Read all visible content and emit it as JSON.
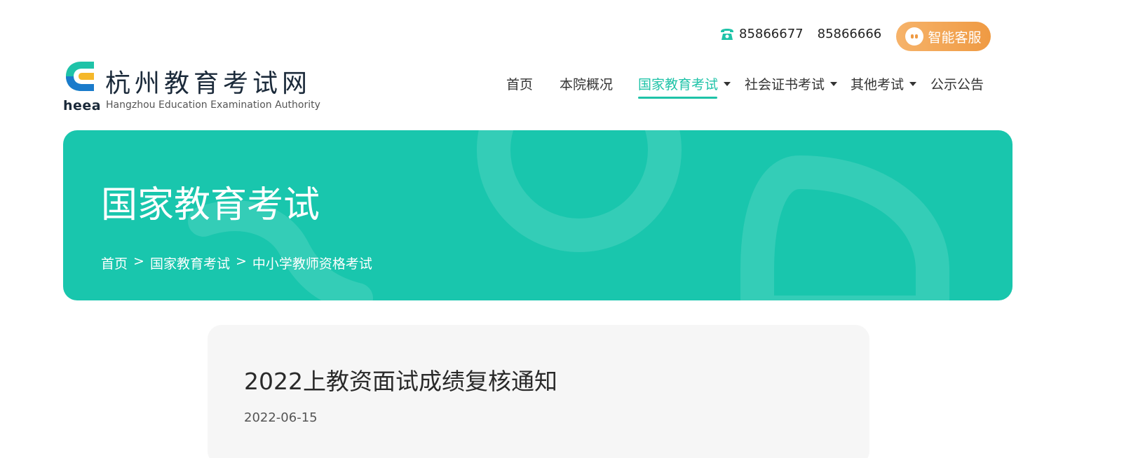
{
  "topbar": {
    "phone_1": "85866677",
    "phone_2": "85866666",
    "service_label": "智能客服"
  },
  "logo": {
    "mark_text": "heea",
    "name_cn": "杭州教育考试网",
    "name_en": "Hangzhou Education Examination Authority"
  },
  "nav": {
    "items": [
      {
        "label": "首页"
      },
      {
        "label": "本院概况"
      },
      {
        "label": "国家教育考试"
      },
      {
        "label": "社会证书考试"
      },
      {
        "label": "其他考试"
      },
      {
        "label": "公示公告"
      }
    ]
  },
  "banner": {
    "title": "国家教育考试",
    "breadcrumb": [
      "首页",
      "国家教育考试",
      "中小学教师资格考试"
    ],
    "separator": ">"
  },
  "article": {
    "title": "2022上教资面试成绩复核通知",
    "date": "2022-06-15"
  },
  "colors": {
    "accent": "#1fc3a8",
    "banner": "#19c6ad",
    "service_gradient_start": "#f6b36a",
    "service_gradient_end": "#ef9a43"
  }
}
